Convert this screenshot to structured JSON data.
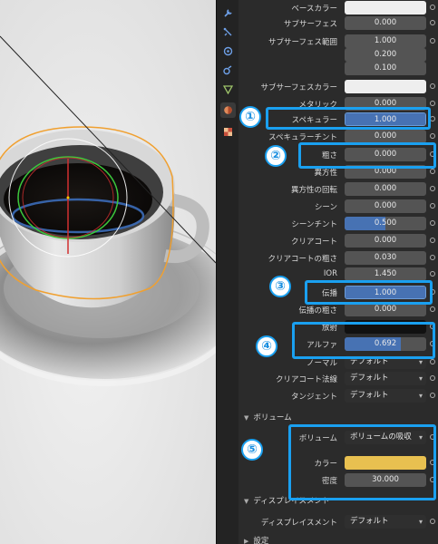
{
  "properties": {
    "base_color": {
      "label": "ベースカラー",
      "value": ""
    },
    "subsurface": {
      "label": "サブサーフェス",
      "value": "0.000"
    },
    "subsurface_radius": {
      "label": "サブサーフェス範囲",
      "values": [
        "1.000",
        "0.200",
        "0.100"
      ]
    },
    "subsurface_color": {
      "label": "サブサーフェスカラー",
      "value": ""
    },
    "metallic": {
      "label": "メタリック",
      "value": "0.000"
    },
    "specular": {
      "label": "スペキュラー",
      "value": "1.000",
      "fill": 1.0
    },
    "specular_tint": {
      "label": "スペキュラーチント",
      "value": "0.000"
    },
    "roughness": {
      "label": "粗さ",
      "value": "0.000"
    },
    "anisotropic": {
      "label": "異方性",
      "value": "0.000"
    },
    "anisotropic_rotation": {
      "label": "異方性の回転",
      "value": "0.000"
    },
    "sheen": {
      "label": "シーン",
      "value": "0.000"
    },
    "sheen_tint": {
      "label": "シーンチント",
      "value": "0.500",
      "fill": 0.5
    },
    "clearcoat": {
      "label": "クリアコート",
      "value": "0.000"
    },
    "clearcoat_roughness": {
      "label": "クリアコートの粗さ",
      "value": "0.030"
    },
    "ior": {
      "label": "IOR",
      "value": "1.450"
    },
    "transmission": {
      "label": "伝播",
      "value": "1.000",
      "fill": 1.0
    },
    "transmission_roughness": {
      "label": "伝播の粗さ",
      "value": "0.000"
    },
    "emission": {
      "label": "放射",
      "value": ""
    },
    "alpha": {
      "label": "アルファ",
      "value": "0.692",
      "fill": 0.692
    },
    "normal": {
      "label": "ノーマル",
      "value": "デフォルト"
    },
    "clearcoat_normal": {
      "label": "クリアコート法線",
      "value": "デフォルト"
    },
    "tangent": {
      "label": "タンジェント",
      "value": "デフォルト"
    }
  },
  "volume_section": {
    "title": "ボリューム",
    "volume": {
      "label": "ボリューム",
      "value": "ボリュームの吸収"
    },
    "color": {
      "label": "カラー",
      "value": "",
      "swatch": "#e8c050"
    },
    "density": {
      "label": "密度",
      "value": "30.000"
    }
  },
  "displacement_section": {
    "title": "ディスプレイスメント",
    "displacement": {
      "label": "ディスプレイスメント",
      "value": "デフォルト"
    }
  },
  "settings_section": {
    "title": "設定"
  },
  "badges": [
    "①",
    "②",
    "③",
    "④",
    "⑤"
  ],
  "colors": {
    "accent": "#4772b3",
    "callout": "#1aa0f0",
    "panel": "#2b2b2b"
  },
  "tool_icons": [
    "wrench-icon",
    "particles-icon",
    "physics-icon",
    "constraints-icon",
    "object-data-icon",
    "material-icon",
    "texture-icon"
  ]
}
